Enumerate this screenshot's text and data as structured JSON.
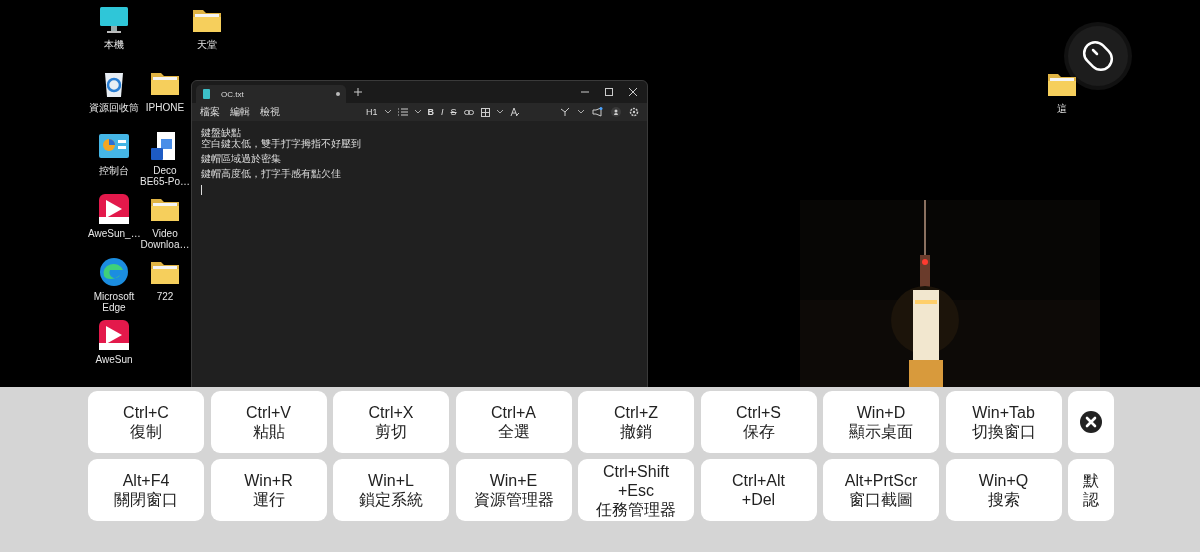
{
  "desktop": {
    "icons": [
      {
        "label": "本機",
        "kind": "monitor"
      },
      {
        "label": "天堂",
        "kind": "folder"
      },
      {
        "label": "資源回收筒",
        "kind": "recycle"
      },
      {
        "label": "IPHONE",
        "kind": "folder"
      },
      {
        "label": "控制台",
        "kind": "control"
      },
      {
        "label": "Deco BE65-Po…",
        "kind": "document"
      },
      {
        "label": "AweSun_…",
        "kind": "app"
      },
      {
        "label": "Video Downloa…",
        "kind": "folder"
      },
      {
        "label": "Microsoft Edge",
        "kind": "browser"
      },
      {
        "label": "722",
        "kind": "folder"
      },
      {
        "label": "AweSun",
        "kind": "app"
      },
      {
        "label": "這",
        "kind": "folder"
      }
    ]
  },
  "notepad": {
    "tab": {
      "title": "OC.txt",
      "unsaved": true
    },
    "menu": [
      "檔案",
      "編輯",
      "檢視"
    ],
    "toolbar": [
      {
        "kind": "heading",
        "label": "H1"
      },
      {
        "kind": "list"
      },
      {
        "kind": "bold",
        "label": "B"
      },
      {
        "kind": "italic",
        "label": "I"
      },
      {
        "kind": "strike",
        "label": "S"
      },
      {
        "kind": "link"
      },
      {
        "kind": "table"
      },
      {
        "kind": "clear"
      }
    ],
    "paragraphs": [
      {
        "lines": [
          "鍵盤缺點",
          "空白鍵太低，雙手打字拇指不好壓到"
        ]
      },
      {
        "lines": [
          "鍵帽區域過於密集"
        ]
      },
      {
        "lines": [
          "鍵帽高度低，打字手感有點欠佳"
        ]
      }
    ]
  },
  "keyboard": {
    "keys": [
      {
        "kind": "shortcut",
        "lines": [
          "Ctrl+C",
          "復制"
        ]
      },
      {
        "kind": "shortcut",
        "lines": [
          "Ctrl+V",
          "粘貼"
        ]
      },
      {
        "kind": "shortcut",
        "lines": [
          "Ctrl+X",
          "剪切"
        ]
      },
      {
        "kind": "shortcut",
        "lines": [
          "Ctrl+A",
          "全選"
        ]
      },
      {
        "kind": "shortcut",
        "lines": [
          "Ctrl+Z",
          "撤銷"
        ]
      },
      {
        "kind": "shortcut",
        "lines": [
          "Ctrl+S",
          "保存"
        ]
      },
      {
        "kind": "shortcut",
        "lines": [
          "Win+D",
          "顯示桌面"
        ]
      },
      {
        "kind": "shortcut",
        "lines": [
          "Win+Tab",
          "切換窗口"
        ]
      },
      {
        "kind": "close"
      },
      {
        "kind": "shortcut",
        "lines": [
          "Alt+F4",
          "關閉窗口"
        ]
      },
      {
        "kind": "shortcut",
        "lines": [
          "Win+R",
          "運行"
        ]
      },
      {
        "kind": "shortcut",
        "lines": [
          "Win+L",
          "鎖定系統"
        ]
      },
      {
        "kind": "shortcut",
        "lines": [
          "Win+E",
          "資源管理器"
        ]
      },
      {
        "kind": "shortcut",
        "lines": [
          "Ctrl+Shift",
          "+Esc",
          "任務管理器"
        ]
      },
      {
        "kind": "shortcut",
        "lines": [
          "Ctrl+Alt",
          "+Del"
        ]
      },
      {
        "kind": "shortcut",
        "lines": [
          "Alt+PrtScr",
          "窗口截圖"
        ]
      },
      {
        "kind": "shortcut",
        "lines": [
          "Win+Q",
          "搜索"
        ]
      },
      {
        "kind": "vertical",
        "label": "默認"
      }
    ]
  }
}
